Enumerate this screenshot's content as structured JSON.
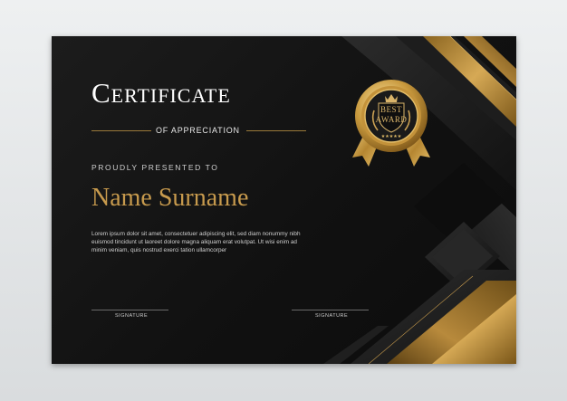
{
  "certificate": {
    "title": "Certificate",
    "subtitle": "OF APPRECIATION",
    "presented_to": "PROUDLY PRESENTED TO",
    "name": "Name Surname",
    "body": "Lorem ipsum dolor sit amet, consectetuer adipiscing elit, sed diam nonummy nibh euismod tincidunt ut laoreet dolore magna aliquam erat volutpat. Ut wisi enim ad minim veniam, quis nostrud exerci tation ullamcorper",
    "signature_left": "SIGNATURE",
    "signature_right": "SIGNATURE"
  },
  "badge": {
    "line1": "BEST",
    "line2": "AWARD"
  },
  "colors": {
    "gold": "#c79a4d",
    "background": "#111111"
  }
}
